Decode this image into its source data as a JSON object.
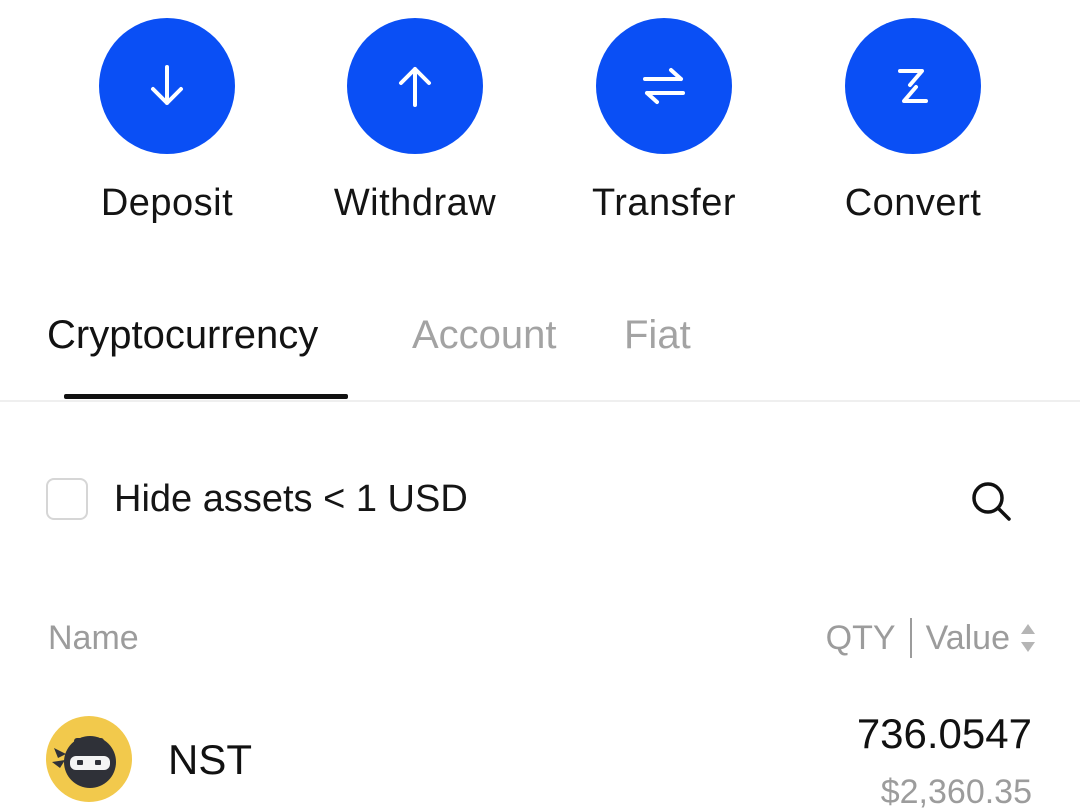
{
  "colors": {
    "accent": "#0a4ff5",
    "text_primary": "#111111",
    "text_muted": "#9c9c9c",
    "coin_bg": "#f2c94c"
  },
  "actions": [
    {
      "label": "Deposit",
      "icon": "arrow-down-icon"
    },
    {
      "label": "Withdraw",
      "icon": "arrow-up-icon"
    },
    {
      "label": "Transfer",
      "icon": "swap-arrows-icon"
    },
    {
      "label": "Convert",
      "icon": "convert-icon"
    }
  ],
  "tabs": [
    {
      "label": "Cryptocurrency",
      "active": true
    },
    {
      "label": "Account",
      "active": false
    },
    {
      "label": "Fiat",
      "active": false
    }
  ],
  "filter": {
    "hide_small_label": "Hide assets < 1 USD",
    "checked": false
  },
  "columns": {
    "name": "Name",
    "qty": "QTY",
    "value": "Value"
  },
  "assets": [
    {
      "symbol": "NST",
      "qty": "736.0547",
      "value": "$2,360.35",
      "icon": "ninja-coin-icon"
    }
  ]
}
